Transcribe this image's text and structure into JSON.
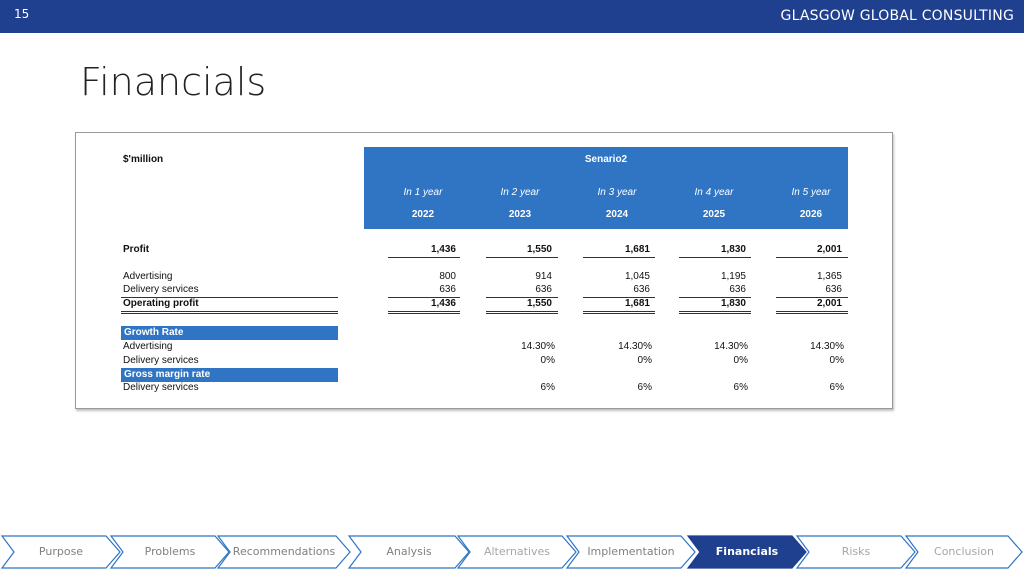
{
  "header": {
    "slide_number": "15",
    "company": "GLASGOW GLOBAL CONSULTING",
    "bar_color": "#1f3f8f"
  },
  "title": "Financials",
  "table": {
    "unit_label": "$'million",
    "scenario_label": "Senario2",
    "header_color": "#2f75c4",
    "year_labels": [
      "In 1 year",
      "In 2 year",
      "In 3 year",
      "In 4 year",
      "In 5 year"
    ],
    "years": [
      "2022",
      "2023",
      "2024",
      "2025",
      "2026"
    ],
    "profit": {
      "label": "Profit",
      "values": [
        "1,436",
        "1,550",
        "1,681",
        "1,830",
        "2,001"
      ]
    },
    "advertising": {
      "label": "Advertising",
      "values": [
        "800",
        "914",
        "1,045",
        "1,195",
        "1,365"
      ]
    },
    "delivery": {
      "label": "Delivery services",
      "values": [
        "636",
        "636",
        "636",
        "636",
        "636"
      ]
    },
    "operating": {
      "label": "Operating profit",
      "values": [
        "1,436",
        "1,550",
        "1,681",
        "1,830",
        "2,001"
      ]
    },
    "growth_header": "Growth Rate",
    "growth_advertising": {
      "label": "Advertising",
      "values": [
        "",
        "14.30%",
        "14.30%",
        "14.30%",
        "14.30%"
      ]
    },
    "growth_delivery": {
      "label": "Delivery services",
      "values": [
        "",
        "0%",
        "0%",
        "0%",
        "0%"
      ]
    },
    "margin_header": "Gross margin rate",
    "margin_delivery": {
      "label": "Delivery services",
      "values": [
        "",
        "6%",
        "6%",
        "6%",
        "6%"
      ]
    }
  },
  "nav": {
    "items": [
      "Purpose",
      "Problems",
      "Recommendations",
      "Analysis",
      "Alternatives",
      "Implementation",
      "Financials",
      "Risks",
      "Conclusion"
    ],
    "active": "Financials",
    "active_color": "#1f3f8f"
  }
}
